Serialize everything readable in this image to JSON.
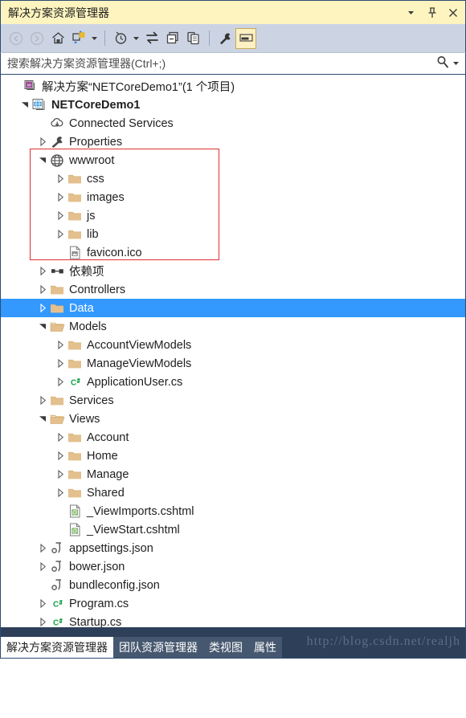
{
  "window": {
    "title": "解决方案资源管理器",
    "buttons": [
      {
        "name": "dropdown-menu-button",
        "glyph": "▾"
      },
      {
        "name": "pin-button",
        "glyph": "⚲"
      },
      {
        "name": "close-button",
        "glyph": "✕"
      }
    ]
  },
  "toolbar": {
    "items": [
      {
        "name": "back-button",
        "icon": "back-arrow-icon",
        "state": "disabled"
      },
      {
        "name": "forward-button",
        "icon": "forward-arrow-icon",
        "state": "disabled"
      },
      {
        "name": "home-button",
        "icon": "home-icon",
        "state": "normal"
      },
      {
        "name": "sync-with-active-document-button",
        "icon": "sync-document-icon",
        "state": "normal"
      },
      {
        "name": "sync-dropdown-button",
        "icon": "chevron-down-icon",
        "state": "normal"
      },
      {
        "name": "pending-changes-button",
        "icon": "clock-icon",
        "state": "normal"
      },
      {
        "name": "pending-changes-dropdown-button",
        "icon": "chevron-down-icon",
        "state": "normal"
      },
      {
        "name": "refresh-button",
        "icon": "refresh-arrows-icon",
        "state": "normal"
      },
      {
        "name": "collapse-all-button",
        "icon": "collapse-all-icon",
        "state": "normal"
      },
      {
        "name": "show-all-files-button",
        "icon": "show-all-files-icon",
        "state": "normal"
      },
      {
        "name": "properties-button",
        "icon": "wrench-icon",
        "state": "normal"
      },
      {
        "name": "preview-selected-items-button",
        "icon": "preview-pane-icon",
        "state": "active"
      }
    ]
  },
  "search": {
    "placeholder": "搜索解决方案资源管理器(Ctrl+;)",
    "value": "",
    "icon": "search-icon",
    "dropdown_glyph": "▾"
  },
  "tree": {
    "nodes": [
      {
        "label": "解决方案“NETCoreDemo1”(1 个项目)",
        "icon": "solution-icon",
        "depth": 0,
        "twisty": "none",
        "bold": false,
        "selected": false
      },
      {
        "label": "NETCoreDemo1",
        "icon": "aspnet-project-icon",
        "depth": 1,
        "twisty": "expanded",
        "bold": true,
        "selected": false
      },
      {
        "label": "Connected Services",
        "icon": "connected-services-icon",
        "depth": 2,
        "twisty": "none",
        "bold": false,
        "selected": false
      },
      {
        "label": "Properties",
        "icon": "wrench-icon",
        "depth": 2,
        "twisty": "collapsed",
        "bold": false,
        "selected": false
      },
      {
        "label": "wwwroot",
        "icon": "globe-icon",
        "depth": 2,
        "twisty": "expanded",
        "bold": false,
        "selected": false
      },
      {
        "label": "css",
        "icon": "folder-icon",
        "depth": 3,
        "twisty": "collapsed",
        "bold": false,
        "selected": false
      },
      {
        "label": "images",
        "icon": "folder-icon",
        "depth": 3,
        "twisty": "collapsed",
        "bold": false,
        "selected": false
      },
      {
        "label": "js",
        "icon": "folder-icon",
        "depth": 3,
        "twisty": "collapsed",
        "bold": false,
        "selected": false
      },
      {
        "label": "lib",
        "icon": "folder-icon",
        "depth": 3,
        "twisty": "collapsed",
        "bold": false,
        "selected": false
      },
      {
        "label": "favicon.ico",
        "icon": "image-file-icon",
        "depth": 3,
        "twisty": "none",
        "bold": false,
        "selected": false
      },
      {
        "label": "依赖项",
        "icon": "dependencies-icon",
        "depth": 2,
        "twisty": "collapsed",
        "bold": false,
        "selected": false
      },
      {
        "label": "Controllers",
        "icon": "folder-icon",
        "depth": 2,
        "twisty": "collapsed",
        "bold": false,
        "selected": false
      },
      {
        "label": "Data",
        "icon": "folder-icon",
        "depth": 2,
        "twisty": "collapsed",
        "bold": false,
        "selected": true
      },
      {
        "label": "Models",
        "icon": "folder-open-icon",
        "depth": 2,
        "twisty": "expanded",
        "bold": false,
        "selected": false
      },
      {
        "label": "AccountViewModels",
        "icon": "folder-icon",
        "depth": 3,
        "twisty": "collapsed",
        "bold": false,
        "selected": false
      },
      {
        "label": "ManageViewModels",
        "icon": "folder-icon",
        "depth": 3,
        "twisty": "collapsed",
        "bold": false,
        "selected": false
      },
      {
        "label": "ApplicationUser.cs",
        "icon": "csharp-file-icon",
        "depth": 3,
        "twisty": "collapsed",
        "bold": false,
        "selected": false
      },
      {
        "label": "Services",
        "icon": "folder-icon",
        "depth": 2,
        "twisty": "collapsed",
        "bold": false,
        "selected": false
      },
      {
        "label": "Views",
        "icon": "folder-open-icon",
        "depth": 2,
        "twisty": "expanded",
        "bold": false,
        "selected": false
      },
      {
        "label": "Account",
        "icon": "folder-icon",
        "depth": 3,
        "twisty": "collapsed",
        "bold": false,
        "selected": false
      },
      {
        "label": "Home",
        "icon": "folder-icon",
        "depth": 3,
        "twisty": "collapsed",
        "bold": false,
        "selected": false
      },
      {
        "label": "Manage",
        "icon": "folder-icon",
        "depth": 3,
        "twisty": "collapsed",
        "bold": false,
        "selected": false
      },
      {
        "label": "Shared",
        "icon": "folder-icon",
        "depth": 3,
        "twisty": "collapsed",
        "bold": false,
        "selected": false
      },
      {
        "label": "_ViewImports.cshtml",
        "icon": "cshtml-file-icon",
        "depth": 3,
        "twisty": "none",
        "bold": false,
        "selected": false
      },
      {
        "label": "_ViewStart.cshtml",
        "icon": "cshtml-file-icon",
        "depth": 3,
        "twisty": "none",
        "bold": false,
        "selected": false
      },
      {
        "label": "appsettings.json",
        "icon": "json-file-icon",
        "depth": 2,
        "twisty": "collapsed",
        "bold": false,
        "selected": false
      },
      {
        "label": "bower.json",
        "icon": "json-file-icon",
        "depth": 2,
        "twisty": "collapsed",
        "bold": false,
        "selected": false
      },
      {
        "label": "bundleconfig.json",
        "icon": "json-file-icon",
        "depth": 2,
        "twisty": "none",
        "bold": false,
        "selected": false
      },
      {
        "label": "Program.cs",
        "icon": "csharp-file-icon",
        "depth": 2,
        "twisty": "collapsed",
        "bold": false,
        "selected": false
      },
      {
        "label": "Startup.cs",
        "icon": "csharp-file-icon",
        "depth": 2,
        "twisty": "collapsed",
        "bold": false,
        "selected": false
      }
    ],
    "annotation": {
      "name": "wwwroot-highlight-box",
      "color": "#e03030"
    }
  },
  "bottom_tabs": {
    "tabs": [
      {
        "label": "解决方案资源管理器",
        "active": true
      },
      {
        "label": "团队资源管理器",
        "active": false
      },
      {
        "label": "类视图",
        "active": false
      },
      {
        "label": "属性",
        "active": false
      }
    ],
    "watermark": "http://blog.csdn.net/realjh"
  },
  "colors": {
    "titlebar_bg": "#fdf4bf",
    "toolbar_bg": "#ccd4e4",
    "selection_bg": "#3399ff",
    "bottom_bg": "#2e4059",
    "folder": "#e3c08d",
    "csharp_green": "#1f9a4a",
    "border": "#2d4b72"
  }
}
